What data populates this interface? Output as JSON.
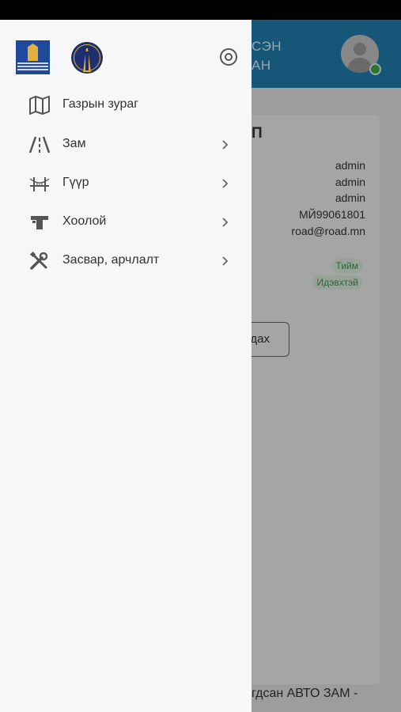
{
  "background": {
    "header_title_line1": "СЭН",
    "header_title_line2": "АН",
    "card_title": "П",
    "info": [
      "admin",
      "admin",
      "admin",
      "МЙ99061801",
      "road@road.mn"
    ],
    "badges": [
      "Тийм",
      "Идэвхтэй"
    ],
    "button_label": "дах",
    "footer_text": "гдсан АВТО ЗАМ -"
  },
  "drawer": {
    "menu": [
      {
        "label": "Газрын зураг",
        "icon": "map-icon",
        "has_chevron": false
      },
      {
        "label": "Зам",
        "icon": "road-icon",
        "has_chevron": true
      },
      {
        "label": "Гүүр",
        "icon": "bridge-icon",
        "has_chevron": true
      },
      {
        "label": "Хоолой",
        "icon": "pipe-icon",
        "has_chevron": true
      },
      {
        "label": "Засвар, арчлалт",
        "icon": "tools-icon",
        "has_chevron": true
      }
    ]
  },
  "colors": {
    "header": "#1f7fb3",
    "drawer": "#f7f7f7",
    "badge_text": "#3c9a52",
    "online": "#3fb048"
  }
}
